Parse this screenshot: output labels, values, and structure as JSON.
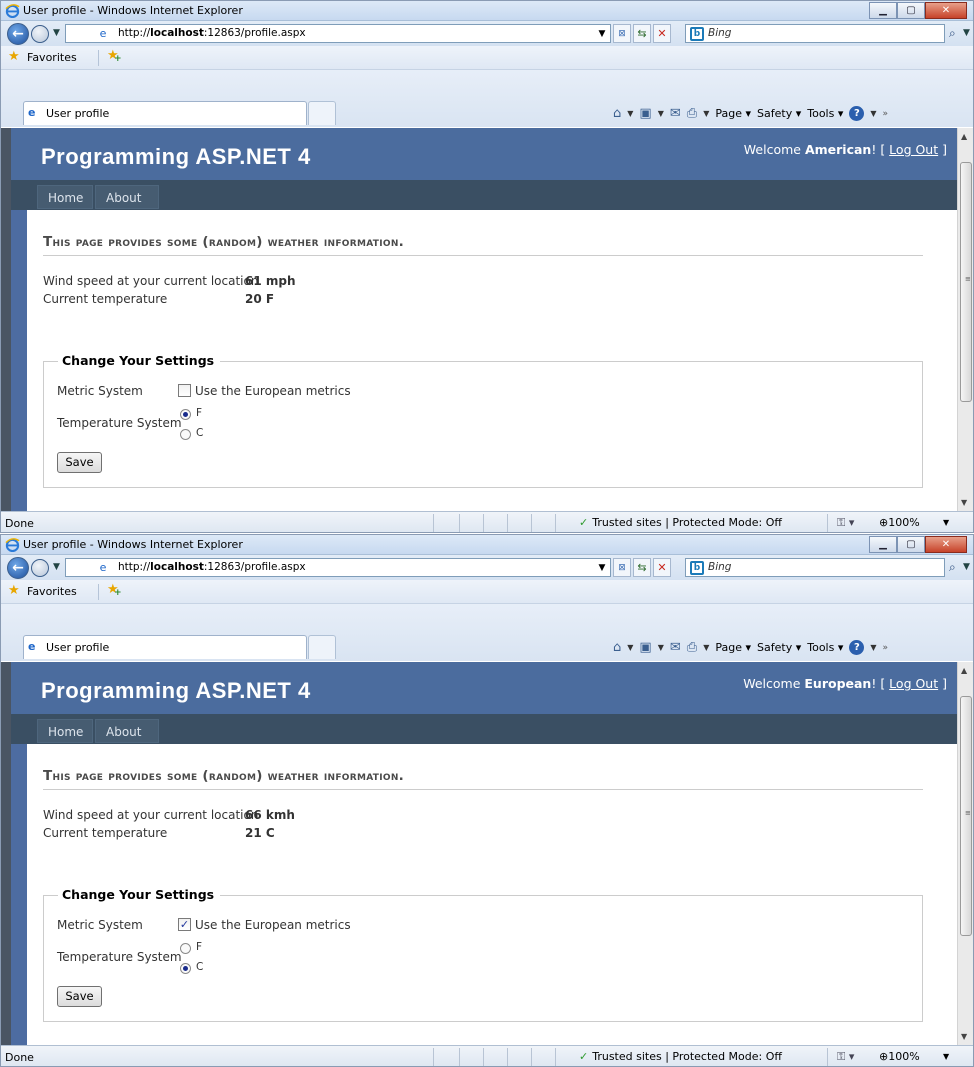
{
  "windows": [
    {
      "window_title": "User profile - Windows Internet Explorer",
      "address": {
        "prefix": "http://",
        "host": "localhost",
        "rest": ":12863/profile.aspx"
      },
      "search_placeholder": "Bing",
      "favorites_label": "Favorites",
      "tab_title": "User profile",
      "commands": {
        "page": "Page",
        "safety": "Safety",
        "tools": "Tools"
      },
      "site": {
        "title": "Programming ASP.NET 4",
        "welcome_prefix": "Welcome ",
        "user_name": "American",
        "welcome_suffix": "! [ ",
        "logout_label": "Log Out",
        "bracket_close": " ]",
        "menu": {
          "home": "Home",
          "about": "About"
        },
        "heading": "This page provides some (random) weather information.",
        "wind_label": "Wind speed at your current location",
        "wind_value": "61 mph",
        "temp_label": "Current temperature",
        "temp_value": "20 F",
        "settings": {
          "legend": "Change Your Settings",
          "metric_label": "Metric System",
          "metric_checkbox_label": "Use the European metrics",
          "metric_checked": false,
          "temp_system_label": "Temperature System",
          "option_f": "F",
          "option_c": "C",
          "selected": "F",
          "save_label": "Save"
        }
      },
      "status": {
        "text": "Done",
        "zone": "Trusted sites | Protected Mode: Off",
        "zoom": "100%"
      }
    },
    {
      "window_title": "User profile - Windows Internet Explorer",
      "address": {
        "prefix": "http://",
        "host": "localhost",
        "rest": ":12863/profile.aspx"
      },
      "search_placeholder": "Bing",
      "favorites_label": "Favorites",
      "tab_title": "User profile",
      "commands": {
        "page": "Page",
        "safety": "Safety",
        "tools": "Tools"
      },
      "site": {
        "title": "Programming ASP.NET 4",
        "welcome_prefix": "Welcome ",
        "user_name": "European",
        "welcome_suffix": "! [ ",
        "logout_label": "Log Out",
        "bracket_close": " ]",
        "menu": {
          "home": "Home",
          "about": "About"
        },
        "heading": "This page provides some (random) weather information.",
        "wind_label": "Wind speed at your current location",
        "wind_value": "66 kmh",
        "temp_label": "Current temperature",
        "temp_value": "21 C",
        "settings": {
          "legend": "Change Your Settings",
          "metric_label": "Metric System",
          "metric_checkbox_label": "Use the European metrics",
          "metric_checked": true,
          "temp_system_label": "Temperature System",
          "option_f": "F",
          "option_c": "C",
          "selected": "C",
          "save_label": "Save"
        }
      },
      "status": {
        "text": "Done",
        "zone": "Trusted sites | Protected Mode: Off",
        "zoom": "100%"
      }
    }
  ]
}
